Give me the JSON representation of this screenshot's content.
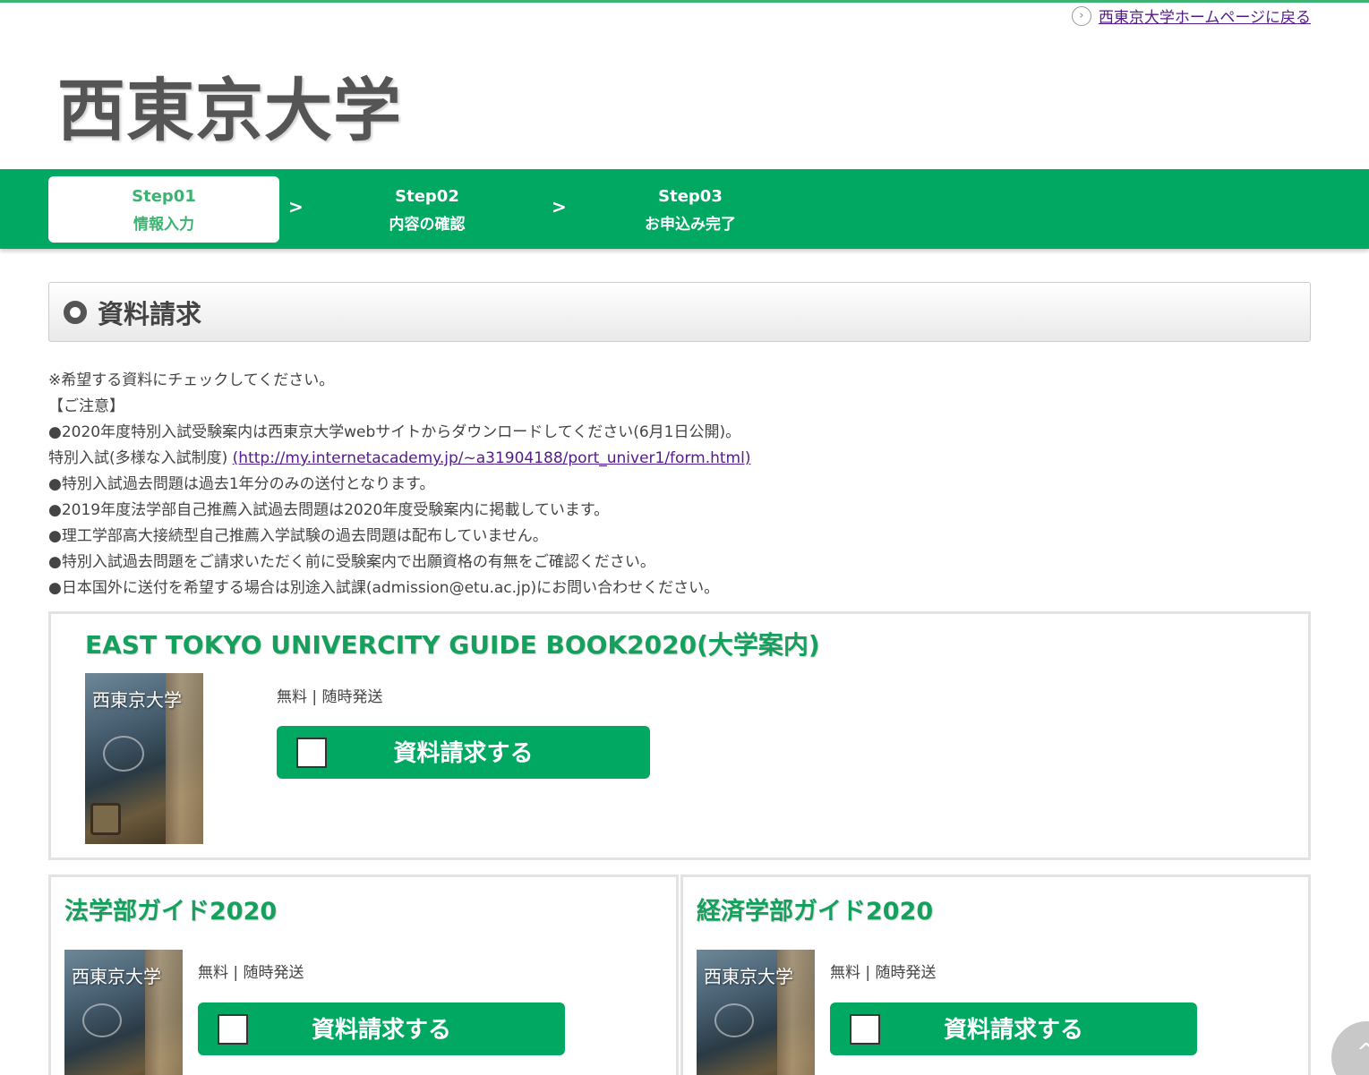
{
  "header": {
    "back_link": "西東京大学ホームページに戻る",
    "logo": "西東京大学"
  },
  "steps": [
    {
      "num": "Step01",
      "label": "情報入力"
    },
    {
      "num": "Step02",
      "label": "内容の確認"
    },
    {
      "num": "Step03",
      "label": "お申込み完了"
    }
  ],
  "step_separator": ">",
  "section_title": "資料請求",
  "notes": {
    "line1": "※希望する資料にチェックしてください。",
    "line2": "【ご注意】",
    "line3": "●2020年度特別入試受験案内は西東京大学webサイトからダウンロードしてください(6月1日公開)。",
    "line4_prefix": "特別入試(多様な入試制度) ",
    "line4_link": "(http://my.internetacademy.jp/~a31904188/port_univer1/form.html)",
    "line5": "●特別入試過去問題は過去1年分のみの送付となります。",
    "line6": "●2019年度法学部自己推薦入試過去問題は2020年度受験案内に掲載しています。",
    "line7": "●理工学部高大接続型自己推薦入学試験の過去問題は配布していません。",
    "line8": "●特別入試過去問題をご請求いただく前に受験案内で出願資格の有無をご確認ください。",
    "line9": "●日本国外に送付を希望する場合は別途入試課(admission@etu.ac.jp)にお問い合わせください。"
  },
  "items": [
    {
      "title": "EAST TOKYO UNIVERCITY GUIDE BOOK2020(大学案内)",
      "meta": "無料 | 随時発送",
      "thumb_label": "西東京大学",
      "button": "資料請求する"
    },
    {
      "title": "法学部ガイド2020",
      "meta": "無料 | 随時発送",
      "thumb_label": "西東京大学",
      "button": "資料請求する"
    },
    {
      "title": "経済学部ガイド2020",
      "meta": "無料 | 随時発送",
      "thumb_label": "西東京大学",
      "button": "資料請求する"
    }
  ],
  "scroll_top_icon": "^"
}
